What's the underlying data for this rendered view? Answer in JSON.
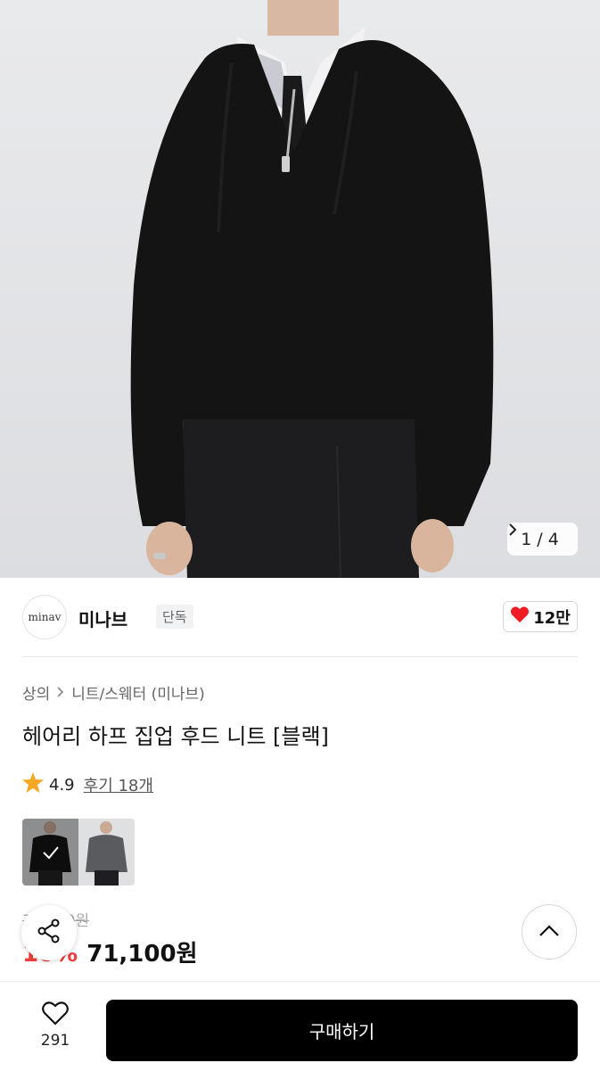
{
  "gallery": {
    "current": "1",
    "separator": "/",
    "total": "4",
    "next_icon": "chevron-right-icon"
  },
  "brand": {
    "logo_text": "minav",
    "name": "미나브",
    "tag": "단독",
    "like_count": "12만",
    "like_color": "#ee1c24"
  },
  "breadcrumb": {
    "category": "상의",
    "subcategory": "니트/스웨터 (미나브)"
  },
  "product": {
    "title": "헤어리 하프 집업 후드 니트 [블랙]"
  },
  "rating": {
    "score": "4.9",
    "reviews_label": "후기 18개",
    "star_color": "#f5a623"
  },
  "price": {
    "original": "79,000원",
    "discount": "10%",
    "sale": "71,100원",
    "discount_color": "#ee3b3b"
  },
  "bottom": {
    "wish_count": "291",
    "buy_label": "구매하기"
  }
}
